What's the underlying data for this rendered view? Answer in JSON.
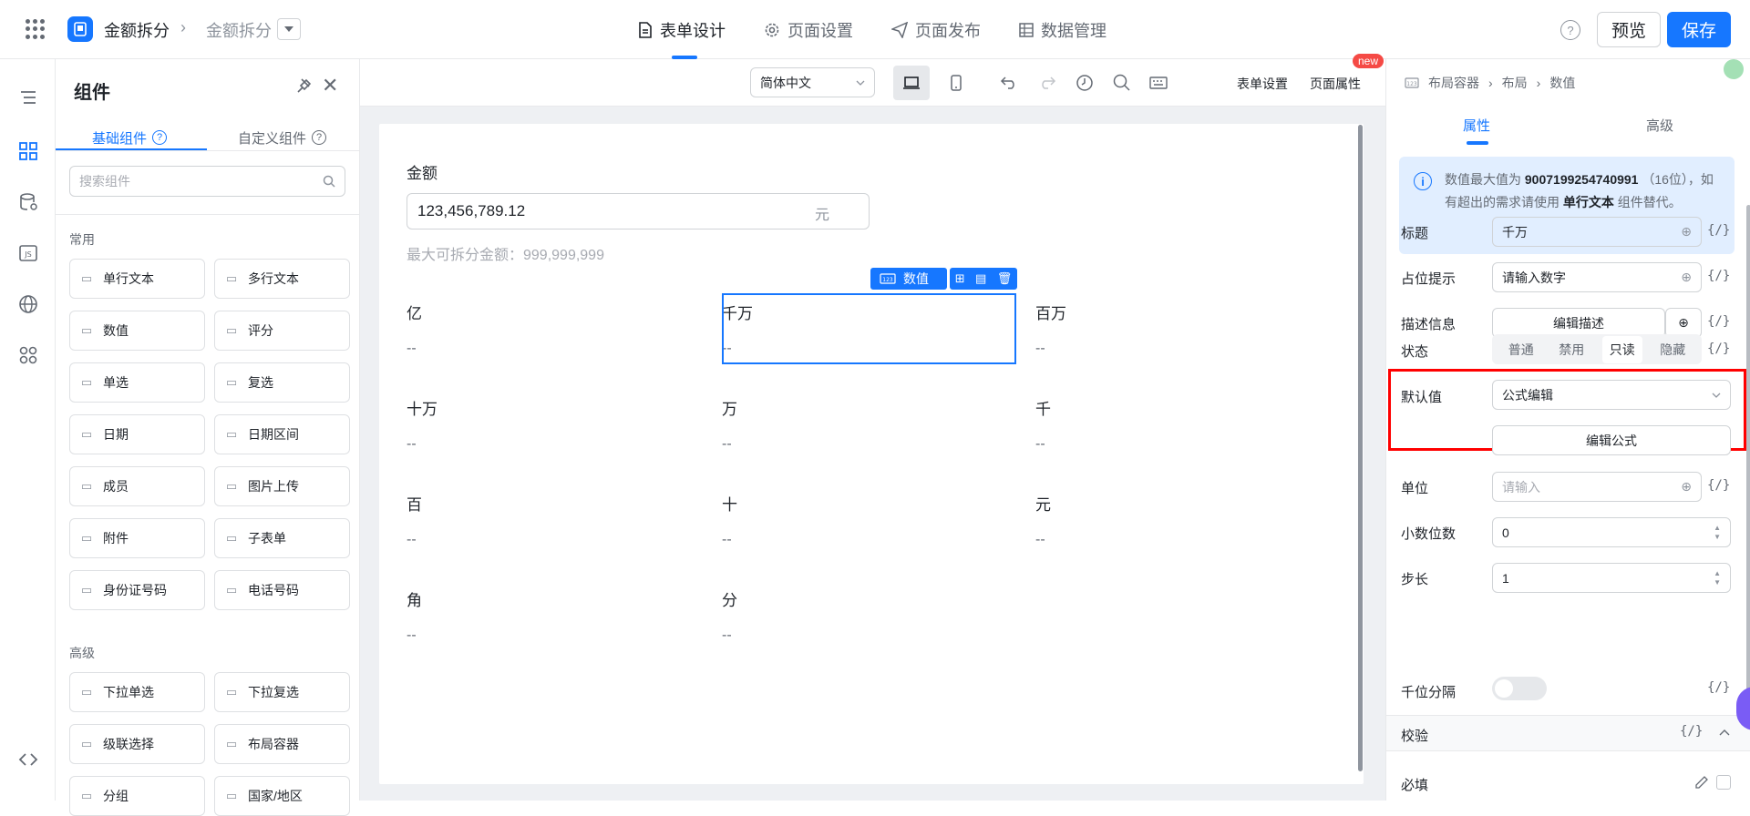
{
  "topbar": {
    "app_name": "金额拆分",
    "page_name": "金额拆分",
    "tabs": [
      {
        "label": "表单设计",
        "icon": "file-icon"
      },
      {
        "label": "页面设置",
        "icon": "gear-icon"
      },
      {
        "label": "页面发布",
        "icon": "send-icon"
      },
      {
        "label": "数据管理",
        "icon": "table-icon"
      }
    ],
    "help": "?",
    "preview_label": "预览",
    "save_label": "保存",
    "accent": "#1677ff"
  },
  "left_rail": {
    "icons": [
      "outline-icon",
      "components-icon",
      "datasource-icon",
      "js-icon",
      "globe-icon",
      "apps-icon",
      "code-icon"
    ]
  },
  "panel": {
    "title": "组件",
    "tabs": [
      "基础组件",
      "自定义组件"
    ],
    "search_placeholder": "搜索组件",
    "section_common": "常用",
    "common_items": [
      {
        "label": "单行文本",
        "icon": "text-field-icon"
      },
      {
        "label": "多行文本",
        "icon": "textarea-icon"
      },
      {
        "label": "数值",
        "icon": "number-icon"
      },
      {
        "label": "评分",
        "icon": "star-icon"
      },
      {
        "label": "单选",
        "icon": "radio-icon"
      },
      {
        "label": "复选",
        "icon": "checkbox-icon"
      },
      {
        "label": "日期",
        "icon": "calendar-icon"
      },
      {
        "label": "日期区间",
        "icon": "calendar-range-icon"
      },
      {
        "label": "成员",
        "icon": "user-icon"
      },
      {
        "label": "图片上传",
        "icon": "image-icon"
      },
      {
        "label": "附件",
        "icon": "paperclip-icon"
      },
      {
        "label": "子表单",
        "icon": "subform-icon"
      },
      {
        "label": "身份证号码",
        "icon": "id-card-icon"
      },
      {
        "label": "电话号码",
        "icon": "phone-icon"
      }
    ],
    "section_advanced": "高级",
    "advanced_items": [
      {
        "label": "下拉单选",
        "icon": "dropdown-icon"
      },
      {
        "label": "下拉复选",
        "icon": "multi-select-icon"
      },
      {
        "label": "级联选择",
        "icon": "cascade-icon"
      },
      {
        "label": "布局容器",
        "icon": "layout-icon"
      },
      {
        "label": "分组",
        "icon": "group-icon"
      },
      {
        "label": "国家/地区",
        "icon": "globe-icon"
      }
    ]
  },
  "toolbar": {
    "language": "简体中文",
    "form_settings": "表单设置",
    "page_props": "页面属性",
    "new_badge": "new"
  },
  "form": {
    "amount_label": "金额",
    "amount_value": "123,456,789.12",
    "amount_unit": "元",
    "hint": "最大可拆分金额：999,999,999",
    "selected_tag": "数值",
    "fields": [
      {
        "label": "亿",
        "value": "--"
      },
      {
        "label": "千万",
        "value": "--"
      },
      {
        "label": "百万",
        "value": "--"
      },
      {
        "label": "十万",
        "value": "--"
      },
      {
        "label": "万",
        "value": "--"
      },
      {
        "label": "千",
        "value": "--"
      },
      {
        "label": "百",
        "value": "--"
      },
      {
        "label": "十",
        "value": "--"
      },
      {
        "label": "元",
        "value": "--"
      },
      {
        "label": "角",
        "value": "--"
      },
      {
        "label": "分",
        "value": "--"
      }
    ]
  },
  "right_panel": {
    "breadcrumb": [
      "布局容器",
      "布局",
      "数值"
    ],
    "tabs": [
      "属性",
      "高级"
    ],
    "info_text_1": "数值最大值为",
    "info_number": "9007199254740991",
    "info_text_2": "（16位），如有超出的需求请使用",
    "info_bold": "单行文本",
    "info_text_3": "组件替代。",
    "title_label": "标题",
    "title_value": "千万",
    "placeholder_label": "占位提示",
    "placeholder_value": "请输入数字",
    "desc_label": "描述信息",
    "desc_button": "编辑描述",
    "status_label": "状态",
    "status_options": [
      "普通",
      "禁用",
      "只读",
      "隐藏"
    ],
    "status_selected": "只读",
    "default_label": "默认值",
    "default_value": "公式编辑",
    "edit_formula": "编辑公式",
    "unit_label": "单位",
    "unit_placeholder": "请输入",
    "decimals_label": "小数位数",
    "decimals_value": "0",
    "step_label": "步长",
    "step_value": "1",
    "thousands_label": "千位分隔",
    "validation_label": "校验",
    "required_label": "必填",
    "fx": "{/}"
  }
}
